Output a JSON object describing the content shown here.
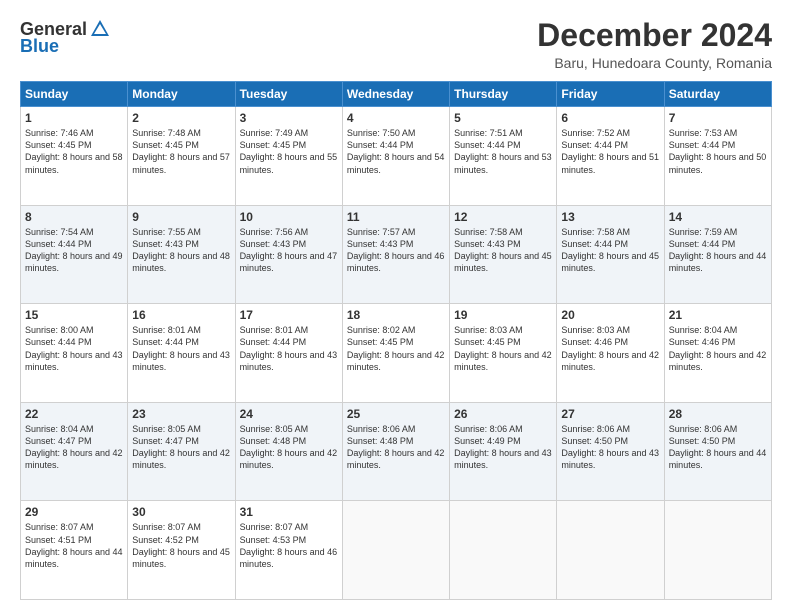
{
  "logo": {
    "general": "General",
    "blue": "Blue"
  },
  "title": "December 2024",
  "location": "Baru, Hunedoara County, Romania",
  "weekdays": [
    "Sunday",
    "Monday",
    "Tuesday",
    "Wednesday",
    "Thursday",
    "Friday",
    "Saturday"
  ],
  "weeks": [
    [
      {
        "day": "1",
        "sunrise": "7:46 AM",
        "sunset": "4:45 PM",
        "daylight": "8 hours and 58 minutes."
      },
      {
        "day": "2",
        "sunrise": "7:48 AM",
        "sunset": "4:45 PM",
        "daylight": "8 hours and 57 minutes."
      },
      {
        "day": "3",
        "sunrise": "7:49 AM",
        "sunset": "4:45 PM",
        "daylight": "8 hours and 55 minutes."
      },
      {
        "day": "4",
        "sunrise": "7:50 AM",
        "sunset": "4:44 PM",
        "daylight": "8 hours and 54 minutes."
      },
      {
        "day": "5",
        "sunrise": "7:51 AM",
        "sunset": "4:44 PM",
        "daylight": "8 hours and 53 minutes."
      },
      {
        "day": "6",
        "sunrise": "7:52 AM",
        "sunset": "4:44 PM",
        "daylight": "8 hours and 51 minutes."
      },
      {
        "day": "7",
        "sunrise": "7:53 AM",
        "sunset": "4:44 PM",
        "daylight": "8 hours and 50 minutes."
      }
    ],
    [
      {
        "day": "8",
        "sunrise": "7:54 AM",
        "sunset": "4:44 PM",
        "daylight": "8 hours and 49 minutes."
      },
      {
        "day": "9",
        "sunrise": "7:55 AM",
        "sunset": "4:43 PM",
        "daylight": "8 hours and 48 minutes."
      },
      {
        "day": "10",
        "sunrise": "7:56 AM",
        "sunset": "4:43 PM",
        "daylight": "8 hours and 47 minutes."
      },
      {
        "day": "11",
        "sunrise": "7:57 AM",
        "sunset": "4:43 PM",
        "daylight": "8 hours and 46 minutes."
      },
      {
        "day": "12",
        "sunrise": "7:58 AM",
        "sunset": "4:43 PM",
        "daylight": "8 hours and 45 minutes."
      },
      {
        "day": "13",
        "sunrise": "7:58 AM",
        "sunset": "4:44 PM",
        "daylight": "8 hours and 45 minutes."
      },
      {
        "day": "14",
        "sunrise": "7:59 AM",
        "sunset": "4:44 PM",
        "daylight": "8 hours and 44 minutes."
      }
    ],
    [
      {
        "day": "15",
        "sunrise": "8:00 AM",
        "sunset": "4:44 PM",
        "daylight": "8 hours and 43 minutes."
      },
      {
        "day": "16",
        "sunrise": "8:01 AM",
        "sunset": "4:44 PM",
        "daylight": "8 hours and 43 minutes."
      },
      {
        "day": "17",
        "sunrise": "8:01 AM",
        "sunset": "4:44 PM",
        "daylight": "8 hours and 43 minutes."
      },
      {
        "day": "18",
        "sunrise": "8:02 AM",
        "sunset": "4:45 PM",
        "daylight": "8 hours and 42 minutes."
      },
      {
        "day": "19",
        "sunrise": "8:03 AM",
        "sunset": "4:45 PM",
        "daylight": "8 hours and 42 minutes."
      },
      {
        "day": "20",
        "sunrise": "8:03 AM",
        "sunset": "4:46 PM",
        "daylight": "8 hours and 42 minutes."
      },
      {
        "day": "21",
        "sunrise": "8:04 AM",
        "sunset": "4:46 PM",
        "daylight": "8 hours and 42 minutes."
      }
    ],
    [
      {
        "day": "22",
        "sunrise": "8:04 AM",
        "sunset": "4:47 PM",
        "daylight": "8 hours and 42 minutes."
      },
      {
        "day": "23",
        "sunrise": "8:05 AM",
        "sunset": "4:47 PM",
        "daylight": "8 hours and 42 minutes."
      },
      {
        "day": "24",
        "sunrise": "8:05 AM",
        "sunset": "4:48 PM",
        "daylight": "8 hours and 42 minutes."
      },
      {
        "day": "25",
        "sunrise": "8:06 AM",
        "sunset": "4:48 PM",
        "daylight": "8 hours and 42 minutes."
      },
      {
        "day": "26",
        "sunrise": "8:06 AM",
        "sunset": "4:49 PM",
        "daylight": "8 hours and 43 minutes."
      },
      {
        "day": "27",
        "sunrise": "8:06 AM",
        "sunset": "4:50 PM",
        "daylight": "8 hours and 43 minutes."
      },
      {
        "day": "28",
        "sunrise": "8:06 AM",
        "sunset": "4:50 PM",
        "daylight": "8 hours and 44 minutes."
      }
    ],
    [
      {
        "day": "29",
        "sunrise": "8:07 AM",
        "sunset": "4:51 PM",
        "daylight": "8 hours and 44 minutes."
      },
      {
        "day": "30",
        "sunrise": "8:07 AM",
        "sunset": "4:52 PM",
        "daylight": "8 hours and 45 minutes."
      },
      {
        "day": "31",
        "sunrise": "8:07 AM",
        "sunset": "4:53 PM",
        "daylight": "8 hours and 46 minutes."
      },
      null,
      null,
      null,
      null
    ]
  ]
}
